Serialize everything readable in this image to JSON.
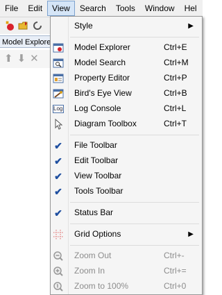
{
  "menubar": {
    "items": [
      "File",
      "Edit",
      "View",
      "Search",
      "Tools",
      "Window",
      "Hel"
    ]
  },
  "panel": {
    "tab_label": "Model Explore"
  },
  "view_menu": {
    "style": {
      "label": "Style"
    },
    "windows": [
      {
        "label": "Model Explorer",
        "shortcut": "Ctrl+E",
        "icon": "model-explorer-icon"
      },
      {
        "label": "Model Search",
        "shortcut": "Ctrl+M",
        "icon": "model-search-icon"
      },
      {
        "label": "Property Editor",
        "shortcut": "Ctrl+P",
        "icon": "property-editor-icon"
      },
      {
        "label": "Bird's Eye View",
        "shortcut": "Ctrl+B",
        "icon": "birds-eye-icon"
      },
      {
        "label": "Log Console",
        "shortcut": "Ctrl+L",
        "icon": "log-console-icon",
        "icon_text": "Log"
      },
      {
        "label": "Diagram Toolbox",
        "shortcut": "Ctrl+T",
        "icon": "pointer-icon"
      }
    ],
    "toolbars": [
      {
        "label": "File Toolbar",
        "checked": true
      },
      {
        "label": "Edit Toolbar",
        "checked": true
      },
      {
        "label": "View Toolbar",
        "checked": true
      },
      {
        "label": "Tools Toolbar",
        "checked": true
      }
    ],
    "status_bar": {
      "label": "Status Bar",
      "checked": true
    },
    "grid_options": {
      "label": "Grid Options"
    },
    "zoom": [
      {
        "label": "Zoom Out",
        "shortcut": "Ctrl+-",
        "icon": "zoom-out-icon"
      },
      {
        "label": "Zoom In",
        "shortcut": "Ctrl+=",
        "icon": "zoom-in-icon"
      },
      {
        "label": "Zoom to 100%",
        "shortcut": "Ctrl+0",
        "icon": "zoom-100-icon"
      }
    ],
    "check_glyph": "✔",
    "submenu_glyph": "▶"
  }
}
